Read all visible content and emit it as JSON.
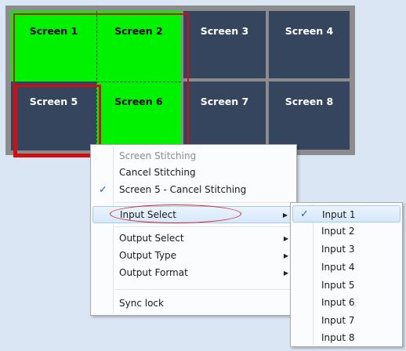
{
  "video_wall": {
    "screens": [
      {
        "label": "Screen 1",
        "state": "stitched"
      },
      {
        "label": "Screen 2",
        "state": "stitched"
      },
      {
        "label": "Screen 3",
        "state": "normal"
      },
      {
        "label": "Screen 4",
        "state": "normal"
      },
      {
        "label": "Screen 5",
        "state": "selected"
      },
      {
        "label": "Screen 6",
        "state": "stitched"
      },
      {
        "label": "Screen 7",
        "state": "normal"
      },
      {
        "label": "Screen 8",
        "state": "normal"
      }
    ],
    "colors": {
      "stitched": "#00f200",
      "normal": "#36455e",
      "frame": "#8c8c8c",
      "selection_border": "#d01010"
    }
  },
  "context_menu": {
    "items": [
      {
        "label": "Screen Stitching",
        "disabled": true
      },
      {
        "label": "Cancel Stitching"
      },
      {
        "label": "Screen 5 - Cancel Stitching",
        "checked": true
      },
      {
        "label": "Input Select",
        "submenu": true,
        "highlighted": true
      },
      {
        "label": "Output Select",
        "submenu": true
      },
      {
        "label": "Output Type",
        "submenu": true
      },
      {
        "label": "Output Format",
        "submenu": true
      },
      {
        "label": "Sync lock"
      }
    ]
  },
  "input_submenu": {
    "items": [
      "Input 1",
      "Input 2",
      "Input 3",
      "Input 4",
      "Input 5",
      "Input 6",
      "Input 7",
      "Input 8"
    ],
    "selected": "Input 1"
  },
  "icons": {
    "check": "checkmark-icon",
    "submenu_arrow": "submenu-arrow-icon"
  }
}
